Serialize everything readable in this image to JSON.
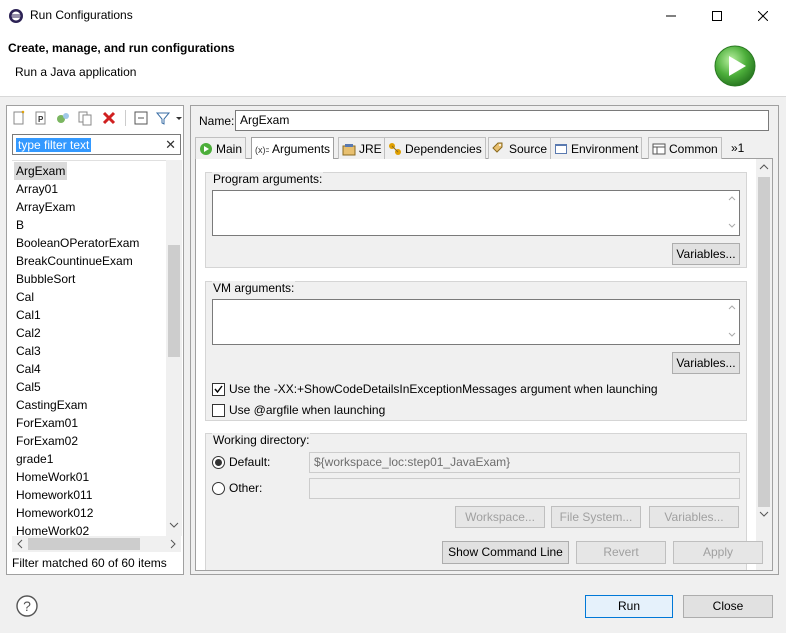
{
  "window": {
    "title": "Run Configurations",
    "minimize": "—",
    "maximize": "☐",
    "close": "✕"
  },
  "header": {
    "title": "Create, manage, and run configurations",
    "subtitle": "Run a Java application"
  },
  "left": {
    "filter_placeholder": "type filter text",
    "filter_clear": "✕",
    "items": [
      "ArgExam",
      "Array01",
      "ArrayExam",
      "B",
      "BooleanOPeratorExam",
      "BreakCountinueExam",
      "BubbleSort",
      "Cal",
      "Cal1",
      "Cal2",
      "Cal3",
      "Cal4",
      "Cal5",
      "CastingExam",
      "ForExam01",
      "ForExam02",
      "grade1",
      "HomeWork01",
      "Homework011",
      "Homework012",
      "HomeWork02"
    ],
    "selected_index": 0,
    "status": "Filter matched 60 of 60 items",
    "scroll_up": "⌃",
    "scroll_down": "⌄"
  },
  "config": {
    "name_label": "Name:",
    "name_value": "ArgExam",
    "tabs": [
      "Main",
      "Arguments",
      "JRE",
      "Dependencies",
      "Source",
      "Environment",
      "Common",
      "»1"
    ],
    "active_tab": 1
  },
  "arguments": {
    "program_label": "Program arguments:",
    "vm_label": "VM arguments:",
    "variables_button": "Variables...",
    "show_code_details": "Use the -XX:+ShowCodeDetailsInExceptionMessages argument when launching",
    "show_code_checked": true,
    "argfile": "Use @argfile when launching",
    "argfile_checked": false,
    "working_dir_label": "Working directory:",
    "default_label": "Default:",
    "default_value": "${workspace_loc:step01_JavaExam}",
    "other_label": "Other:",
    "workspace_button": "Workspace...",
    "file_system_button": "File System...",
    "variables_button_wd": "Variables..."
  },
  "actions": {
    "show_command_line": "Show Command Line",
    "revert": "Revert",
    "apply": "Apply",
    "run": "Run",
    "close": "Close"
  },
  "colors": {
    "accent": "#0078d7",
    "selection": "#3399ff",
    "run_green": "#3fa63f"
  }
}
